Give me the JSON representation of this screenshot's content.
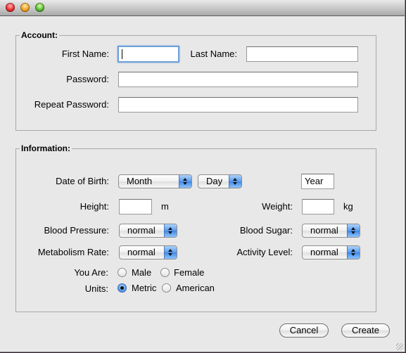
{
  "window": {
    "title": "",
    "controls": [
      "close",
      "minimize",
      "zoom"
    ]
  },
  "account": {
    "title": "Account:",
    "first_name_label": "First Name:",
    "first_name_value": "",
    "last_name_label": "Last Name:",
    "last_name_value": "",
    "password_label": "Password:",
    "password_value": "",
    "repeat_password_label": "Repeat Password:",
    "repeat_password_value": ""
  },
  "information": {
    "title": "Information:",
    "dob_label": "Date of Birth:",
    "month_value": "Month",
    "day_value": "Day",
    "year_value": "Year",
    "height_label": "Height:",
    "height_value": "",
    "height_unit": "m",
    "weight_label": "Weight:",
    "weight_value": "",
    "weight_unit": "kg",
    "blood_pressure_label": "Blood Pressure:",
    "blood_pressure_value": "normal",
    "blood_sugar_label": "Blood Sugar:",
    "blood_sugar_value": "normal",
    "metabolism_label": "Metabolism Rate:",
    "metabolism_value": "normal",
    "activity_label": "Activity Level:",
    "activity_value": "normal",
    "gender_label": "You Are:",
    "gender_options": [
      {
        "label": "Male",
        "checked": false
      },
      {
        "label": "Female",
        "checked": false
      }
    ],
    "units_label": "Units:",
    "units_options": [
      {
        "label": "Metric",
        "checked": true
      },
      {
        "label": "American",
        "checked": false
      }
    ]
  },
  "buttons": {
    "cancel": "Cancel",
    "create": "Create"
  },
  "colors": {
    "window_bg": "#e8e8e8",
    "focus_ring": "#6fa0d8",
    "accent_blue": "#3f86e3"
  }
}
